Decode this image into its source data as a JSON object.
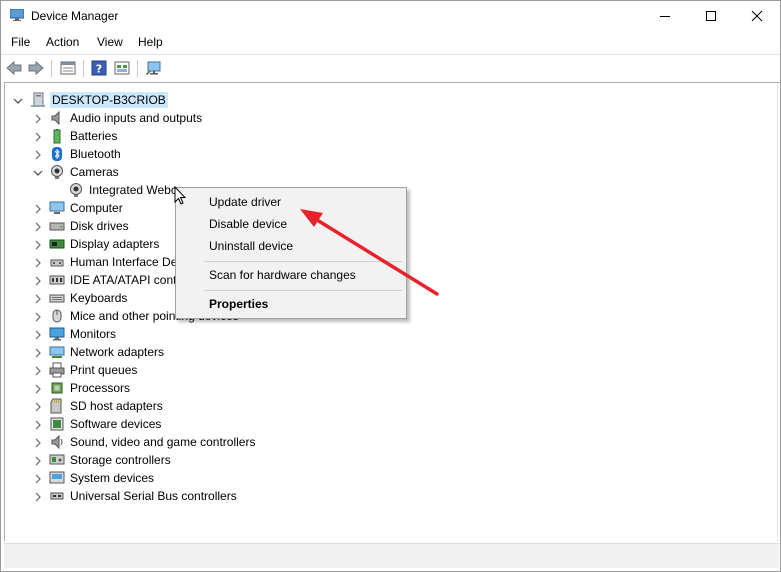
{
  "window": {
    "title": "Device Manager",
    "controls": [
      "minimize",
      "maximize",
      "close"
    ]
  },
  "menu": [
    "File",
    "Action",
    "View",
    "Help"
  ],
  "toolbar": {
    "icons": [
      "back-arrow-icon",
      "forward-arrow-icon",
      "properties-grid-icon",
      "help-icon",
      "show-hidden-icon",
      "scan-monitor-icon"
    ]
  },
  "tree": {
    "root": "DESKTOP-B3CRIOB",
    "categories": [
      {
        "label": "Audio inputs and outputs",
        "icon": "speaker-icon",
        "expanded": false
      },
      {
        "label": "Batteries",
        "icon": "battery-icon",
        "expanded": false
      },
      {
        "label": "Bluetooth",
        "icon": "bluetooth-icon",
        "expanded": false
      },
      {
        "label": "Cameras",
        "icon": "camera-icon",
        "expanded": true
      },
      {
        "label": "Computer",
        "icon": "computer-icon",
        "expanded": false
      },
      {
        "label": "Disk drives",
        "icon": "disk-icon",
        "expanded": false
      },
      {
        "label": "Display adapters",
        "icon": "display-adapter-icon",
        "expanded": false
      },
      {
        "label": "Human Interface Devices",
        "icon": "hid-icon",
        "expanded": false
      },
      {
        "label": "IDE ATA/ATAPI controllers",
        "icon": "ide-controller-icon",
        "expanded": false
      },
      {
        "label": "Keyboards",
        "icon": "keyboard-icon",
        "expanded": false
      },
      {
        "label": "Mice and other pointing devices",
        "icon": "mouse-icon",
        "expanded": false
      },
      {
        "label": "Monitors",
        "icon": "monitor-icon",
        "expanded": false
      },
      {
        "label": "Network adapters",
        "icon": "network-icon",
        "expanded": false
      },
      {
        "label": "Print queues",
        "icon": "printer-icon",
        "expanded": false
      },
      {
        "label": "Processors",
        "icon": "processor-icon",
        "expanded": false
      },
      {
        "label": "SD host adapters",
        "icon": "sd-card-icon",
        "expanded": false
      },
      {
        "label": "Software devices",
        "icon": "software-device-icon",
        "expanded": false
      },
      {
        "label": "Sound, video and game controllers",
        "icon": "sound-icon",
        "expanded": false
      },
      {
        "label": "Storage controllers",
        "icon": "storage-icon",
        "expanded": false
      },
      {
        "label": "System devices",
        "icon": "system-device-icon",
        "expanded": false
      },
      {
        "label": "Universal Serial Bus controllers",
        "icon": "usb-icon",
        "expanded": false
      }
    ],
    "camera_child": "Integrated Webcam"
  },
  "context_menu": {
    "items": [
      "Update driver",
      "Disable device",
      "Uninstall device",
      "Scan for hardware changes",
      "Properties"
    ],
    "bold_item": "Properties"
  },
  "colors": {
    "selection": "#cce8ff",
    "arrow": "#e8222a",
    "menu_bg": "#f2f2f2"
  }
}
